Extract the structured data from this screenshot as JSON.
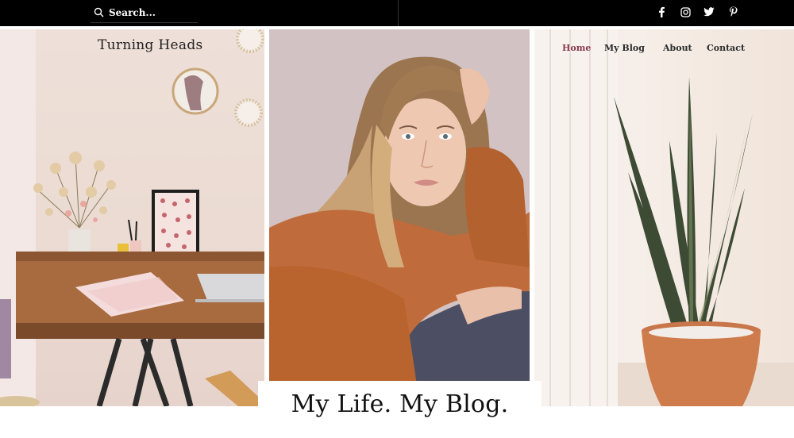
{
  "search": {
    "placeholder": "Search..."
  },
  "social": [
    {
      "icon": "facebook-icon"
    },
    {
      "icon": "instagram-icon"
    },
    {
      "icon": "twitter-icon"
    },
    {
      "icon": "pinterest-icon"
    }
  ],
  "site": {
    "brand": "Turning Heads"
  },
  "nav": {
    "items": [
      {
        "label": "Home",
        "active": true
      },
      {
        "label": "My Blog",
        "active": false
      },
      {
        "label": "About",
        "active": false
      },
      {
        "label": "Contact",
        "active": false
      }
    ]
  },
  "hero": {
    "title": "My Life. My Blog."
  },
  "colors": {
    "topbar": "#000000",
    "accent": "#8a3b4d",
    "text": "#222222"
  }
}
